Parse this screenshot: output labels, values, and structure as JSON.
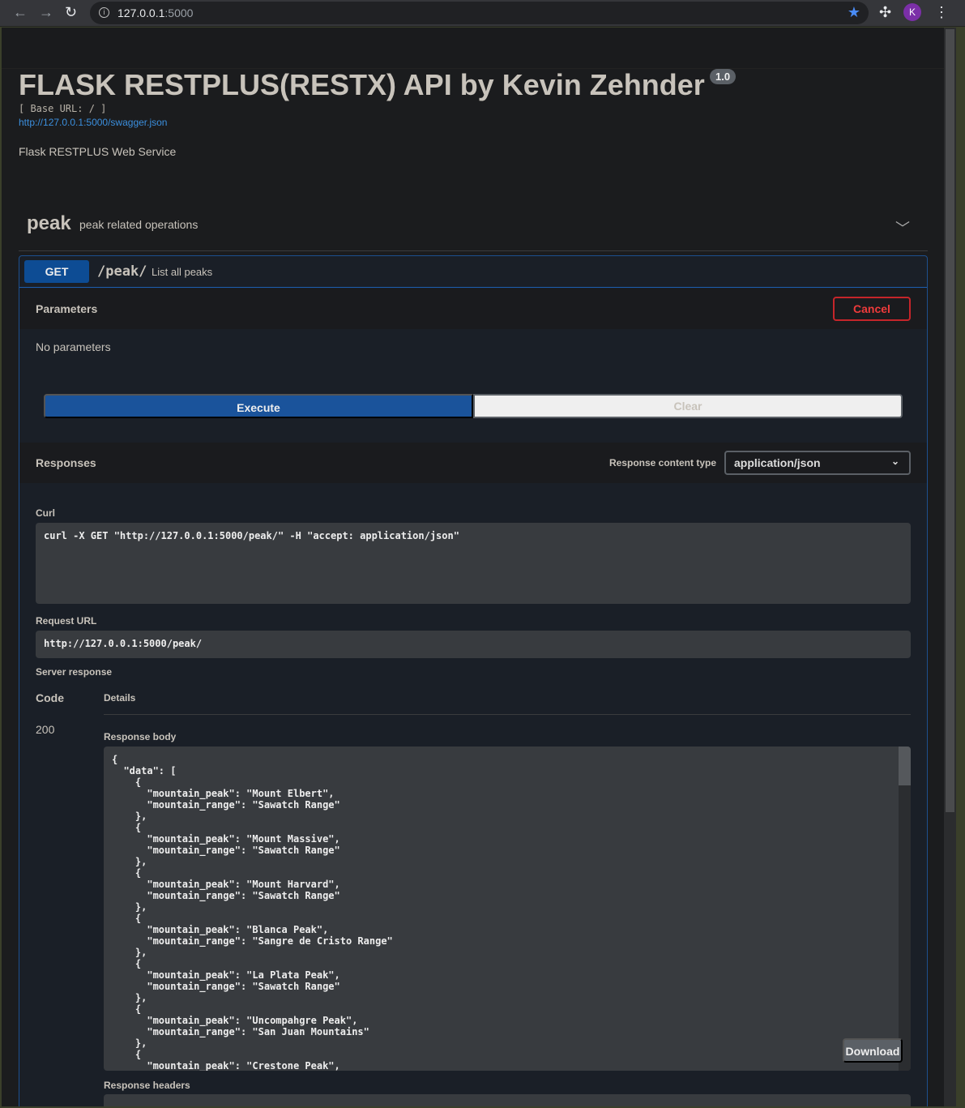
{
  "browser": {
    "url_host": "127.0.0.1",
    "url_port": ":5000",
    "avatar_letter": "K"
  },
  "header": {
    "title": "FLASK RESTPLUS(RESTX) API by Kevin Zehnder",
    "version": "1.0",
    "base_url": "[ Base URL: / ]",
    "spec_link": "http://127.0.0.1:5000/swagger.json",
    "description": "Flask RESTPLUS Web Service"
  },
  "tag": {
    "name": "peak",
    "description": "peak related operations"
  },
  "operation": {
    "method": "GET",
    "path": "/peak/",
    "summary": "List all peaks",
    "parameters_label": "Parameters",
    "cancel_label": "Cancel",
    "no_params": "No parameters",
    "execute_label": "Execute",
    "clear_label": "Clear",
    "responses_label": "Responses",
    "content_type_label": "Response content type",
    "content_type": "application/json",
    "curl_label": "Curl",
    "curl": "curl -X GET \"http://127.0.0.1:5000/peak/\" -H \"accept: application/json\"",
    "request_url_label": "Request URL",
    "request_url": "http://127.0.0.1:5000/peak/",
    "server_response_label": "Server response",
    "code_header": "Code",
    "details_header": "Details",
    "status_code": "200",
    "response_body_label": "Response body",
    "response_body": "{\n  \"data\": [\n    {\n      \"mountain_peak\": \"Mount Elbert\",\n      \"mountain_range\": \"Sawatch Range\"\n    },\n    {\n      \"mountain_peak\": \"Mount Massive\",\n      \"mountain_range\": \"Sawatch Range\"\n    },\n    {\n      \"mountain_peak\": \"Mount Harvard\",\n      \"mountain_range\": \"Sawatch Range\"\n    },\n    {\n      \"mountain_peak\": \"Blanca Peak\",\n      \"mountain_range\": \"Sangre de Cristo Range\"\n    },\n    {\n      \"mountain_peak\": \"La Plata Peak\",\n      \"mountain_range\": \"Sawatch Range\"\n    },\n    {\n      \"mountain_peak\": \"Uncompahgre Peak\",\n      \"mountain_range\": \"San Juan Mountains\"\n    },\n    {\n      \"mountain_peak\": \"Crestone Peak\",",
    "download_label": "Download",
    "response_headers_label": "Response headers"
  }
}
